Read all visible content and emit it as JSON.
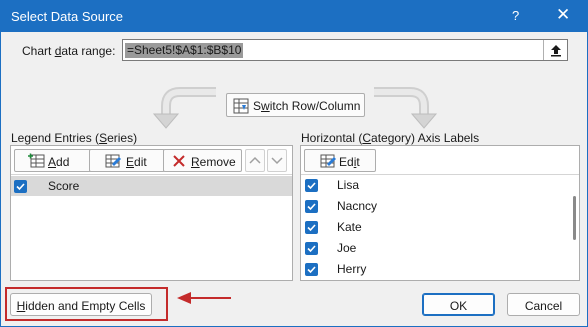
{
  "window": {
    "title": "Select Data Source",
    "help_glyph": "?",
    "close_glyph": "✕"
  },
  "range": {
    "label_pre": "Chart ",
    "label_u": "d",
    "label_post": "ata range:",
    "value": "=Sheet5!$A$1:$B$10"
  },
  "switch": {
    "label_pre": "S",
    "label_u": "w",
    "label_post": "itch Row/Column"
  },
  "legend": {
    "label_pre": "Legend Entries (",
    "label_u": "S",
    "label_post": "eries)",
    "add_u": "A",
    "add_rest": "dd",
    "edit_u": "E",
    "edit_rest": "dit",
    "remove_u": "R",
    "remove_rest": "emove",
    "series": [
      {
        "name": "Score",
        "checked": true
      }
    ]
  },
  "axis": {
    "label_pre": "Horizontal (",
    "label_u": "C",
    "label_post": "ategory) Axis Labels",
    "edit_pre": "Ed",
    "edit_u": "i",
    "edit_post": "t",
    "categories": [
      {
        "name": "Lisa",
        "checked": true
      },
      {
        "name": "Nacncy",
        "checked": true
      },
      {
        "name": "Kate",
        "checked": true
      },
      {
        "name": "Joe",
        "checked": true
      },
      {
        "name": "Herry",
        "checked": true
      }
    ]
  },
  "footer": {
    "hidden_u": "H",
    "hidden_rest": "idden and Empty Cells",
    "ok": "OK",
    "cancel": "Cancel"
  },
  "colors": {
    "titlebar": "#1c6fc2",
    "annotation": "#c42b2b"
  }
}
